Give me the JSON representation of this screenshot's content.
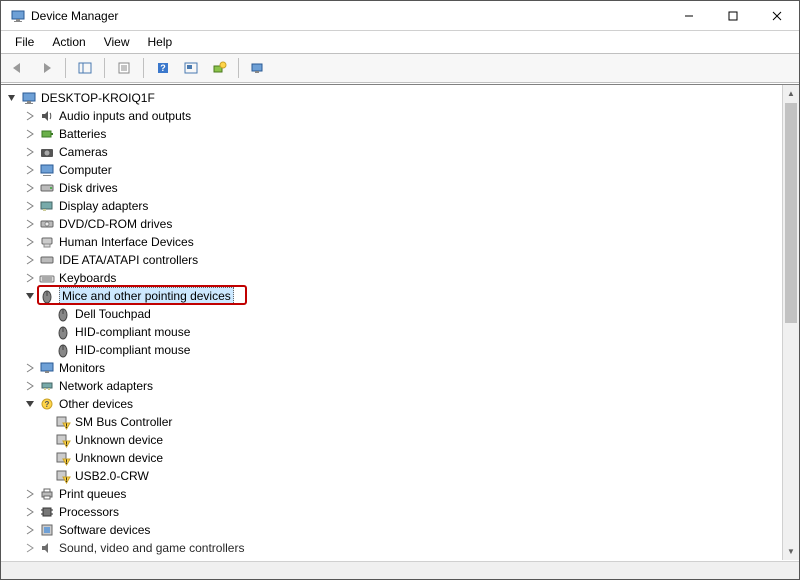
{
  "window": {
    "title": "Device Manager"
  },
  "menu": {
    "file": "File",
    "action": "Action",
    "view": "View",
    "help": "Help"
  },
  "tree": {
    "root": "DESKTOP-KROIQ1F",
    "audio": "Audio inputs and outputs",
    "batteries": "Batteries",
    "cameras": "Cameras",
    "computer": "Computer",
    "disk": "Disk drives",
    "display": "Display adapters",
    "dvd": "DVD/CD-ROM drives",
    "hid": "Human Interface Devices",
    "ide": "IDE ATA/ATAPI controllers",
    "keyboards": "Keyboards",
    "mice": "Mice and other pointing devices",
    "mice_children": {
      "dell": "Dell Touchpad",
      "hid1": "HID-compliant mouse",
      "hid2": "HID-compliant mouse"
    },
    "monitors": "Monitors",
    "network": "Network adapters",
    "other": "Other devices",
    "other_children": {
      "sm": "SM Bus Controller",
      "unk1": "Unknown device",
      "unk2": "Unknown device",
      "usb": "USB2.0-CRW"
    },
    "print": "Print queues",
    "processors": "Processors",
    "software": "Software devices",
    "sound": "Sound, video and game controllers"
  }
}
